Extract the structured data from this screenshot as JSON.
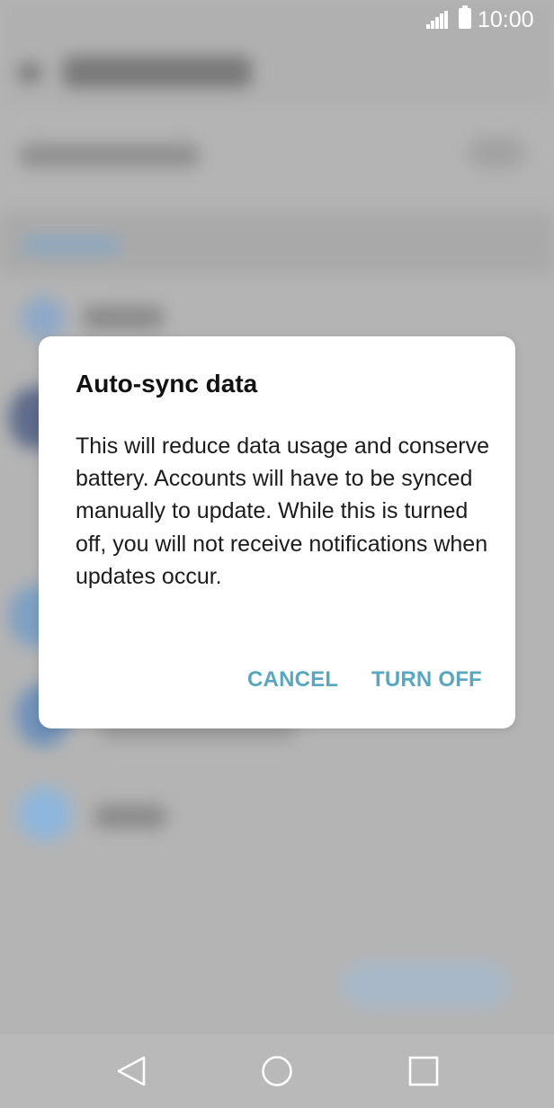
{
  "status_bar": {
    "time": "10:00",
    "signal_icon": "signal-icon",
    "battery_icon": "battery-icon"
  },
  "dialog": {
    "title": "Auto-sync data",
    "message": "This will reduce data usage and conserve battery. Accounts will have to be synced manually to update. While this is turned off, you will not receive notifications when updates occur.",
    "cancel_label": "CANCEL",
    "confirm_label": "TURN OFF",
    "accent_color": "#5aa6bf"
  },
  "nav_bar": {
    "back_icon": "back-triangle-icon",
    "home_icon": "home-circle-icon",
    "recent_icon": "recent-apps-square-icon"
  }
}
